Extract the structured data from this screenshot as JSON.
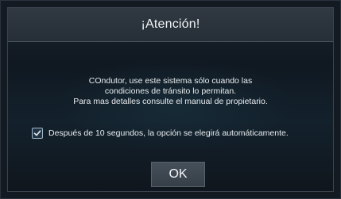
{
  "dialog": {
    "title": "¡Atención!",
    "message_lines": [
      "COndutor, use este sistema sólo cuando las",
      "condiciones de tránsito lo permitan.",
      "Para mas detalles consulte el manual de propietario."
    ],
    "checkbox": {
      "label": "Después de 10 segundos, la opción se elegirá automáticamente.",
      "checked": true
    },
    "ok_label": "OK"
  },
  "colors": {
    "background": "#141a21",
    "title_bar": "#2b333c",
    "text": "#e9edf0",
    "accent": "#9fb8c8",
    "button": "#3e4852"
  }
}
